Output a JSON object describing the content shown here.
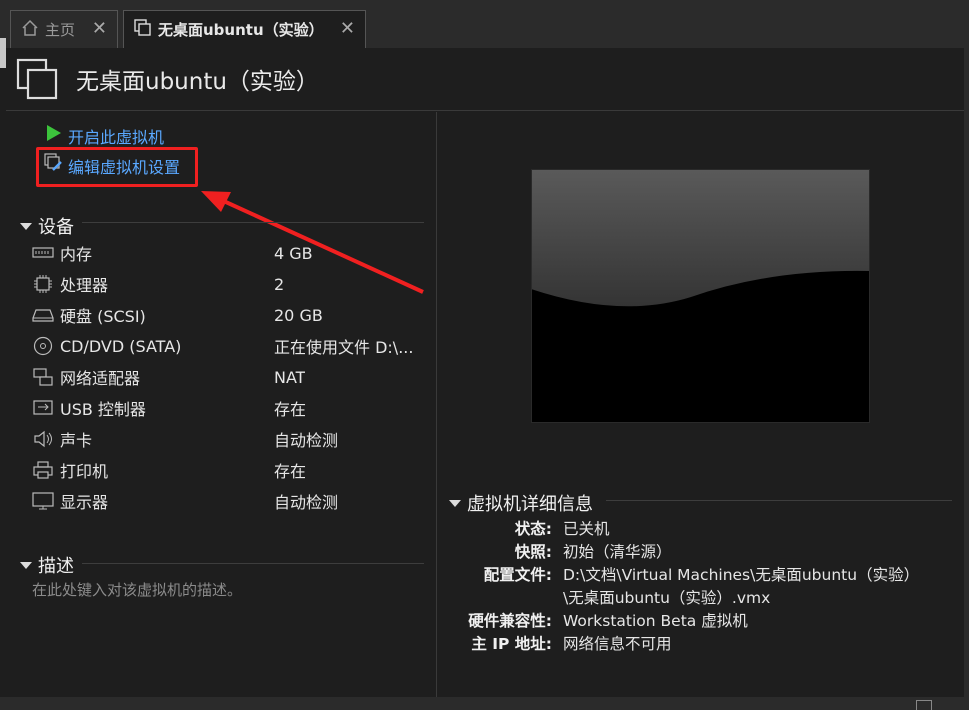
{
  "tabs": [
    {
      "label": "主页",
      "icon": "home-icon"
    },
    {
      "label": "无桌面ubuntu（实验）",
      "icon": "vm-icon"
    }
  ],
  "header": {
    "title": "无桌面ubuntu（实验）"
  },
  "actions": {
    "power_on": "开启此虚拟机",
    "edit_settings": "编辑虚拟机设置"
  },
  "devices": {
    "section_title": "设备",
    "items": [
      {
        "name": "内存",
        "value": "4 GB",
        "icon": "memory-icon"
      },
      {
        "name": "处理器",
        "value": "2",
        "icon": "cpu-icon"
      },
      {
        "name": "硬盘 (SCSI)",
        "value": "20 GB",
        "icon": "hard-disk-icon"
      },
      {
        "name": "CD/DVD (SATA)",
        "value": "正在使用文件 D:\\...",
        "icon": "cd-dvd-icon"
      },
      {
        "name": "网络适配器",
        "value": "NAT",
        "icon": "network-adapter-icon"
      },
      {
        "name": "USB 控制器",
        "value": "存在",
        "icon": "usb-icon"
      },
      {
        "name": "声卡",
        "value": "自动检测",
        "icon": "sound-icon"
      },
      {
        "name": "打印机",
        "value": "存在",
        "icon": "printer-icon"
      },
      {
        "name": "显示器",
        "value": "自动检测",
        "icon": "display-icon"
      }
    ]
  },
  "description": {
    "section_title": "描述",
    "placeholder": "在此处键入对该虚拟机的描述。"
  },
  "details": {
    "section_title": "虚拟机详细信息",
    "rows": [
      {
        "label": "状态:",
        "value": "已关机"
      },
      {
        "label": "快照:",
        "value": "初始（清华源）"
      },
      {
        "label": "配置文件:",
        "value": "D:\\文档\\Virtual Machines\\无桌面ubuntu（实验）",
        "value2": "\\无桌面ubuntu（实验）.vmx"
      },
      {
        "label": "硬件兼容性:",
        "value": "Workstation Beta 虚拟机"
      },
      {
        "label": "主 IP 地址:",
        "value": "网络信息不可用"
      }
    ]
  },
  "colors": {
    "link": "#5aa8ff",
    "annotation": "#f02020",
    "play": "#3cc43c"
  }
}
